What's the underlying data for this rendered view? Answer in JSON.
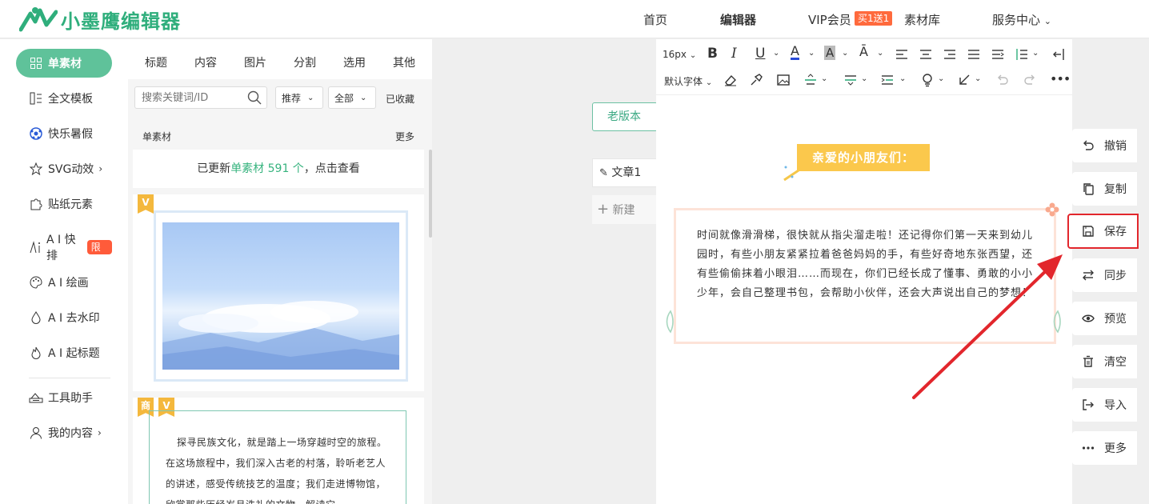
{
  "brand": {
    "name": "小墨鹰编辑器",
    "color": "#2fae7c"
  },
  "nav": {
    "home": "首页",
    "editor": "编辑器",
    "vip": "VIP会员",
    "vip_badge": "买1送1",
    "materials": "素材库",
    "service": "服务中心"
  },
  "sidebar": {
    "items": [
      {
        "label": "单素材",
        "icon": "grid-icon"
      },
      {
        "label": "全文模板",
        "icon": "template-icon"
      },
      {
        "label": "快乐暑假",
        "icon": "ball-icon"
      },
      {
        "label": "SVG动效",
        "icon": "star-icon"
      },
      {
        "label": "贴纸元素",
        "icon": "puzzle-icon"
      },
      {
        "label": "A I 快排",
        "icon": "ai-icon",
        "badge": "限免"
      },
      {
        "label": "A I 绘画",
        "icon": "palette-icon"
      },
      {
        "label": "A I 去水印",
        "icon": "drop-icon"
      },
      {
        "label": "A I 起标题",
        "icon": "fire-icon"
      },
      {
        "label": "工具助手",
        "icon": "tool-icon"
      },
      {
        "label": "我的内容",
        "icon": "user-icon"
      }
    ]
  },
  "panel": {
    "tabs": [
      "标题",
      "内容",
      "图片",
      "分割",
      "选用",
      "其他"
    ],
    "search_placeholder": "搜索关键词/ID",
    "sort": "推荐",
    "filter": "全部",
    "favorites": "已收藏",
    "list_title": "单素材",
    "more": "更多",
    "update_prefix": "已更新",
    "update_highlight": "单素材 591 个",
    "update_suffix": "，点击查看",
    "card_badge_v": "V",
    "card_badge_biz": "商",
    "card2_text": "探寻民族文化，就是踏上一场穿越时空的旅程。在这场旅程中，我们深入古老的村落，聆听老艺人的讲述，感受传统技艺的温度；我们走进博物馆，欣赏那些历经岁月洗礼的文物，解读它"
  },
  "workspace": {
    "old_version": "老版本",
    "article": "文章1",
    "new": "新建"
  },
  "toolbar": {
    "font_size": "16px",
    "font_family": "默认字体"
  },
  "editor": {
    "heading": "亲爱的小朋友们：",
    "body": "时间就像滑滑梯，很快就从指尖溜走啦！还记得你们第一天来到幼儿园时，有些小朋友紧紧拉着爸爸妈妈的手，有些好奇地东张西望，还有些偷偷抹着小眼泪……而现在，你们已经长成了懂事、勇敢的小小少年，会自己整理书包，会帮助小伙伴，还会大声说出自己的梦想！"
  },
  "actions": {
    "undo": "撤销",
    "copy": "复制",
    "save": "保存",
    "sync": "同步",
    "preview": "预览",
    "clear": "清空",
    "import": "导入",
    "more": "更多"
  },
  "colors": {
    "accent": "#5fc29a",
    "highlight": "#e2262c",
    "heading_bg": "#fbc84c"
  }
}
